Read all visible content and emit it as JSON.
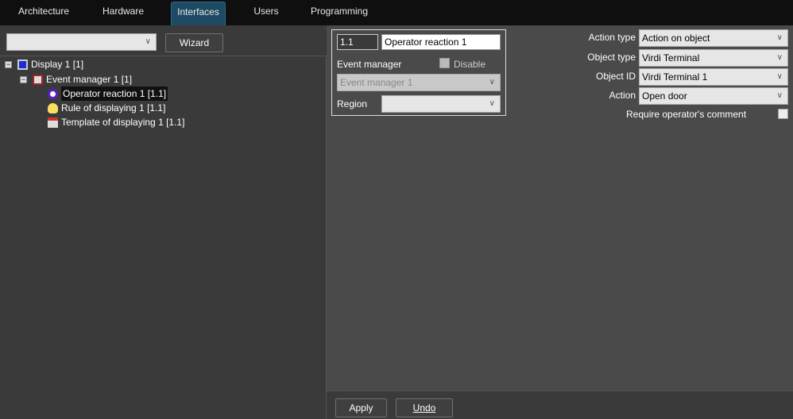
{
  "tabs": [
    "Architecture",
    "Hardware",
    "Interfaces",
    "Users",
    "Programming"
  ],
  "active_tab": "Interfaces",
  "left": {
    "filter_value": "",
    "wizard_label": "Wizard"
  },
  "tree": [
    {
      "label": "Display 1 [1]",
      "icon": "monitor-icon"
    },
    {
      "label": "Event manager 1 [1]",
      "icon": "event-manager-icon"
    },
    {
      "label": "Operator reaction 1 [1.1]",
      "icon": "eye-icon",
      "selected": true
    },
    {
      "label": "Rule of displaying 1 [1.1]",
      "icon": "lightbulb-icon"
    },
    {
      "label": "Template of displaying 1 [1.1]",
      "icon": "template-icon"
    }
  ],
  "form": {
    "id": "1.1",
    "name": "Operator reaction 1",
    "event_manager_label": "Event manager",
    "disable_label": "Disable",
    "event_manager_value": "Event manager 1",
    "region_label": "Region",
    "region_value": ""
  },
  "settings": {
    "action_type_label": "Action type",
    "action_type_value": "Action on object",
    "object_type_label": "Object type",
    "object_type_value": "Virdi Terminal",
    "object_id_label": "Object ID",
    "object_id_value": "Virdi Terminal 1",
    "action_label": "Action",
    "action_value": "Open door",
    "require_comment_label": "Require operator's comment"
  },
  "buttons": {
    "apply": "Apply",
    "undo": "Undo"
  }
}
